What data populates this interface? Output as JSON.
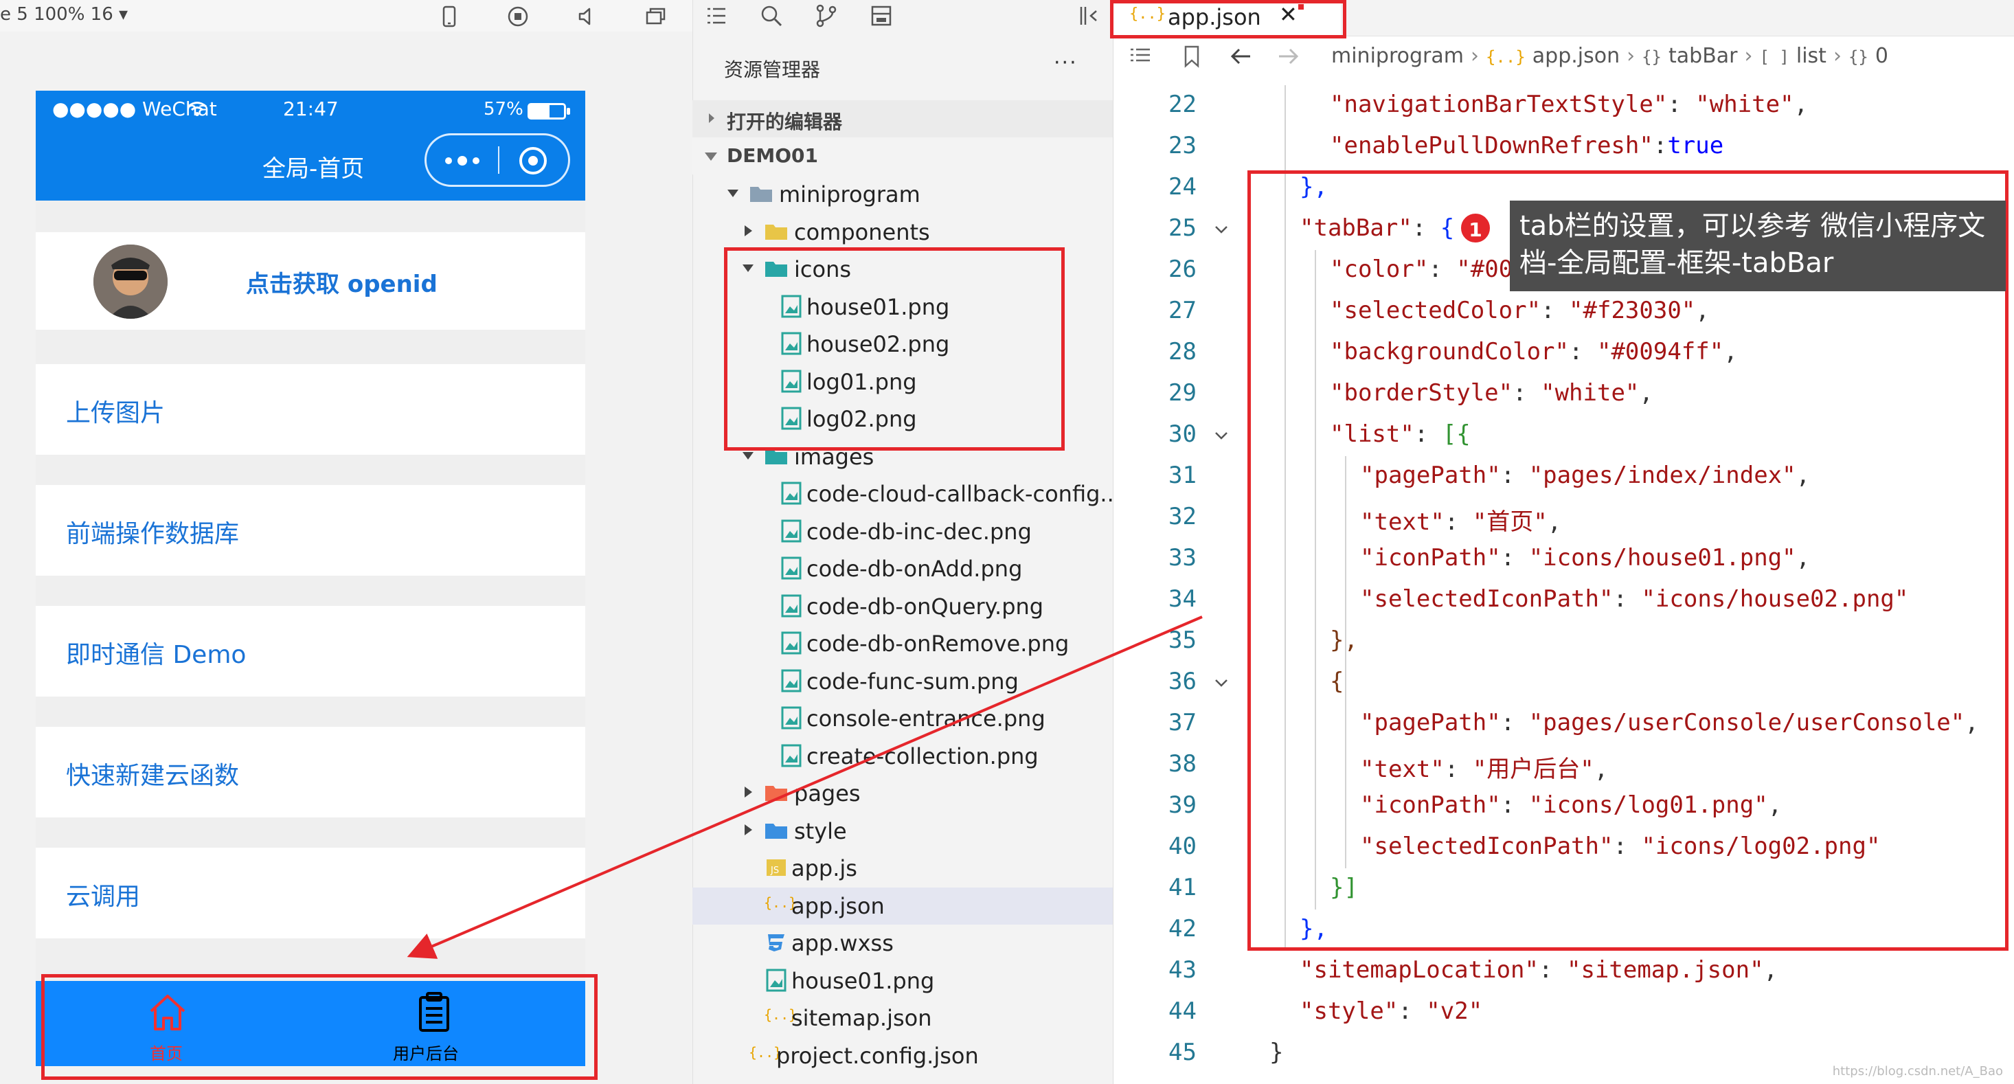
{
  "simulator": {
    "zoom_text": "e 5 100% 16 ▾",
    "status": {
      "carrier": "●●●●● WeChat",
      "time": "21:47",
      "battery": "57%",
      "battery_level": 0.57
    },
    "nav_title": "全局-首页",
    "openid_label": "点击获取 openid",
    "menu": [
      "上传图片",
      "前端操作数据库",
      "即时通信 Demo",
      "快速新建云函数",
      "云调用"
    ],
    "tabbar": {
      "home_label": "首页",
      "console_label": "用户后台",
      "home_color": "#f23030",
      "console_color": "#000000"
    }
  },
  "explorer": {
    "title": "资源管理器",
    "more": "···",
    "open_editors": "打开的编辑器",
    "project": "DEMO01",
    "tree": [
      {
        "label": "miniprogram",
        "type": "folder",
        "depth": 1,
        "expanded": true
      },
      {
        "label": "components",
        "type": "folder-components",
        "depth": 2,
        "expanded": false
      },
      {
        "label": "icons",
        "type": "folder-icons",
        "depth": 2,
        "expanded": true
      },
      {
        "label": "house01.png",
        "type": "image",
        "depth": 3
      },
      {
        "label": "house02.png",
        "type": "image",
        "depth": 3
      },
      {
        "label": "log01.png",
        "type": "image",
        "depth": 3
      },
      {
        "label": "log02.png",
        "type": "image",
        "depth": 3
      },
      {
        "label": "images",
        "type": "folder-images",
        "depth": 2,
        "expanded": true
      },
      {
        "label": "code-cloud-callback-config....",
        "type": "image",
        "depth": 3
      },
      {
        "label": "code-db-inc-dec.png",
        "type": "image",
        "depth": 3
      },
      {
        "label": "code-db-onAdd.png",
        "type": "image",
        "depth": 3
      },
      {
        "label": "code-db-onQuery.png",
        "type": "image",
        "depth": 3
      },
      {
        "label": "code-db-onRemove.png",
        "type": "image",
        "depth": 3
      },
      {
        "label": "code-func-sum.png",
        "type": "image",
        "depth": 3
      },
      {
        "label": "console-entrance.png",
        "type": "image",
        "depth": 3
      },
      {
        "label": "create-collection.png",
        "type": "image",
        "depth": 3
      },
      {
        "label": "pages",
        "type": "folder-pages",
        "depth": 2,
        "expanded": false
      },
      {
        "label": "style",
        "type": "folder-style",
        "depth": 2,
        "expanded": false
      },
      {
        "label": "app.js",
        "type": "js",
        "depth": 2
      },
      {
        "label": "app.json",
        "type": "json",
        "depth": 2,
        "selected": true
      },
      {
        "label": "app.wxss",
        "type": "css",
        "depth": 2
      },
      {
        "label": "house01.png",
        "type": "image",
        "depth": 2
      },
      {
        "label": "sitemap.json",
        "type": "json",
        "depth": 2
      },
      {
        "label": "project.config.json",
        "type": "json",
        "depth": 1
      }
    ]
  },
  "editor": {
    "tab_label": "app.json",
    "tab_close": "✕",
    "breadcrumb": [
      {
        "icon": "",
        "text": "miniprogram"
      },
      {
        "icon": "{..}",
        "text": "app.json"
      },
      {
        "icon": "{}",
        "text": "tabBar"
      },
      {
        "icon": "[ ]",
        "text": "list"
      },
      {
        "icon": "{}",
        "text": "0"
      }
    ],
    "lines": [
      {
        "n": "22",
        "indent": 2,
        "key": "navigationBarTextStyle",
        "sep": ": ",
        "value": "\"white\"",
        "tail": ","
      },
      {
        "n": "23",
        "indent": 2,
        "key": "enablePullDownRefresh",
        "sep": ":",
        "value": "true",
        "tail": "",
        "kw": true
      },
      {
        "n": "24",
        "indent": 1,
        "raw": "},",
        "br": "b1"
      },
      {
        "n": "25",
        "indent": 1,
        "key": "tabBar",
        "sep": ": ",
        "raw_after": "{",
        "br": "b1",
        "fold": true
      },
      {
        "n": "26",
        "indent": 2,
        "key": "color",
        "sep": ": ",
        "value": "\"#000",
        "tail": ""
      },
      {
        "n": "27",
        "indent": 2,
        "key": "selectedColor",
        "sep": ": ",
        "value": "\"#f23030\"",
        "tail": ","
      },
      {
        "n": "28",
        "indent": 2,
        "key": "backgroundColor",
        "sep": ": ",
        "value": "\"#0094ff\"",
        "tail": ","
      },
      {
        "n": "29",
        "indent": 2,
        "key": "borderStyle",
        "sep": ": ",
        "value": "\"white\"",
        "tail": ","
      },
      {
        "n": "30",
        "indent": 2,
        "key": "list",
        "sep": ": ",
        "raw_after": "[{",
        "br": "b2",
        "fold": true
      },
      {
        "n": "31",
        "indent": 3,
        "key": "pagePath",
        "sep": ": ",
        "value": "\"pages/index/index\"",
        "tail": ","
      },
      {
        "n": "32",
        "indent": 3,
        "key": "text",
        "sep": ": ",
        "value": "\"首页\"",
        "tail": ","
      },
      {
        "n": "33",
        "indent": 3,
        "key": "iconPath",
        "sep": ": ",
        "value": "\"icons/house01.png\"",
        "tail": ","
      },
      {
        "n": "34",
        "indent": 3,
        "key": "selectedIconPath",
        "sep": ": ",
        "value": "\"icons/house02.png\"",
        "tail": ""
      },
      {
        "n": "35",
        "indent": 2,
        "raw": "},",
        "br": "b3"
      },
      {
        "n": "36",
        "indent": 2,
        "raw": "{",
        "br": "b3",
        "fold": true
      },
      {
        "n": "37",
        "indent": 3,
        "key": "pagePath",
        "sep": ": ",
        "value": "\"pages/userConsole/userConsole\"",
        "tail": ","
      },
      {
        "n": "38",
        "indent": 3,
        "key": "text",
        "sep": ": ",
        "value": "\"用户后台\"",
        "tail": ","
      },
      {
        "n": "39",
        "indent": 3,
        "key": "iconPath",
        "sep": ": ",
        "value": "\"icons/log01.png\"",
        "tail": ","
      },
      {
        "n": "40",
        "indent": 3,
        "key": "selectedIconPath",
        "sep": ": ",
        "value": "\"icons/log02.png\"",
        "tail": ""
      },
      {
        "n": "41",
        "indent": 2,
        "raw": "}]",
        "br": "b2"
      },
      {
        "n": "42",
        "indent": 1,
        "raw": "},",
        "br": "b1"
      },
      {
        "n": "43",
        "indent": 1,
        "key": "sitemapLocation",
        "sep": ": ",
        "value": "\"sitemap.json\"",
        "tail": ","
      },
      {
        "n": "44",
        "indent": 1,
        "key": "style",
        "sep": ": ",
        "value": "\"v2\"",
        "tail": ""
      },
      {
        "n": "45",
        "indent": 0,
        "raw": "}",
        "br": "p"
      }
    ]
  },
  "annotation": {
    "badge": "1",
    "text": "tab栏的设置，可以参考 微信小程序文档-全局配置-框架-tabBar"
  },
  "watermark": "https://blog.csdn.net/A_Bao",
  "colors": {
    "accent_red": "#e5262b",
    "nav_blue": "#0a7fea",
    "tab_blue": "#0f87ff"
  }
}
